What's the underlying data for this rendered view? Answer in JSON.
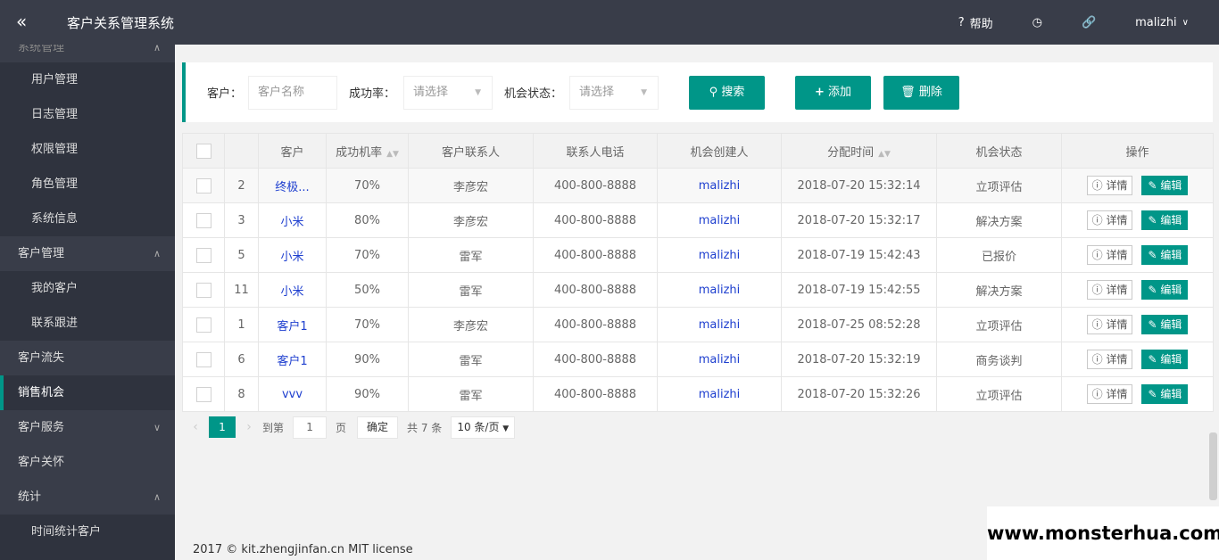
{
  "header": {
    "title": "客户关系管理系统",
    "help": "帮助",
    "user": "malizhi"
  },
  "sidebar": {
    "items": [
      {
        "label": "系统管理",
        "type": "cut"
      },
      {
        "label": "用户管理",
        "type": "sub"
      },
      {
        "label": "日志管理",
        "type": "sub"
      },
      {
        "label": "权限管理",
        "type": "sub"
      },
      {
        "label": "角色管理",
        "type": "sub"
      },
      {
        "label": "系统信息",
        "type": "sub"
      },
      {
        "label": "客户管理",
        "type": "group"
      },
      {
        "label": "我的客户",
        "type": "sub"
      },
      {
        "label": "联系跟进",
        "type": "sub"
      },
      {
        "label": "客户流失",
        "type": "top"
      },
      {
        "label": "销售机会",
        "type": "active"
      },
      {
        "label": "客户服务",
        "type": "group"
      },
      {
        "label": "客户关怀",
        "type": "top"
      },
      {
        "label": "统计",
        "type": "group"
      },
      {
        "label": "时间统计客户",
        "type": "sub"
      },
      {
        "label": "",
        "type": "sub"
      }
    ]
  },
  "search": {
    "customer_label": "客户：",
    "customer_placeholder": "客户名称",
    "rate_label": "成功率：",
    "rate_value": "请选择",
    "status_label": "机会状态：",
    "status_value": "请选择",
    "search_btn": "搜索",
    "add_btn": "添加",
    "delete_btn": "删除"
  },
  "table": {
    "headers": [
      "",
      "",
      "客户",
      "成功机率",
      "客户联系人",
      "联系人电话",
      "机会创建人",
      "分配时间",
      "机会状态",
      "操作"
    ],
    "detail_label": "详情",
    "edit_label": "编辑",
    "rows": [
      {
        "id": "2",
        "customer": "终极...",
        "rate": "70%",
        "contact": "李彦宏",
        "phone": "400-800-8888",
        "creator": "malizhi",
        "time": "2018-07-20 15:32:14",
        "status": "立项评估"
      },
      {
        "id": "3",
        "customer": "小米",
        "rate": "80%",
        "contact": "李彦宏",
        "phone": "400-800-8888",
        "creator": "malizhi",
        "time": "2018-07-20 15:32:17",
        "status": "解决方案"
      },
      {
        "id": "5",
        "customer": "小米",
        "rate": "70%",
        "contact": "雷军",
        "phone": "400-800-8888",
        "creator": "malizhi",
        "time": "2018-07-19 15:42:43",
        "status": "已报价"
      },
      {
        "id": "11",
        "customer": "小米",
        "rate": "50%",
        "contact": "雷军",
        "phone": "400-800-8888",
        "creator": "malizhi",
        "time": "2018-07-19 15:42:55",
        "status": "解决方案"
      },
      {
        "id": "1",
        "customer": "客户1",
        "rate": "70%",
        "contact": "李彦宏",
        "phone": "400-800-8888",
        "creator": "malizhi",
        "time": "2018-07-25 08:52:28",
        "status": "立项评估"
      },
      {
        "id": "6",
        "customer": "客户1",
        "rate": "90%",
        "contact": "雷军",
        "phone": "400-800-8888",
        "creator": "malizhi",
        "time": "2018-07-20 15:32:19",
        "status": "商务谈判"
      },
      {
        "id": "8",
        "customer": "vvv",
        "rate": "90%",
        "contact": "雷军",
        "phone": "400-800-8888",
        "creator": "malizhi",
        "time": "2018-07-20 15:32:26",
        "status": "立项评估"
      }
    ]
  },
  "pager": {
    "current": "1",
    "goto_label": "到第",
    "goto_value": "1",
    "page_label": "页",
    "confirm": "确定",
    "total": "共 7 条",
    "size": "10 条/页"
  },
  "footer": {
    "text": "2017 © kit.zhengjinfan.cn MIT license"
  },
  "watermark": "www.monsterhua.com"
}
